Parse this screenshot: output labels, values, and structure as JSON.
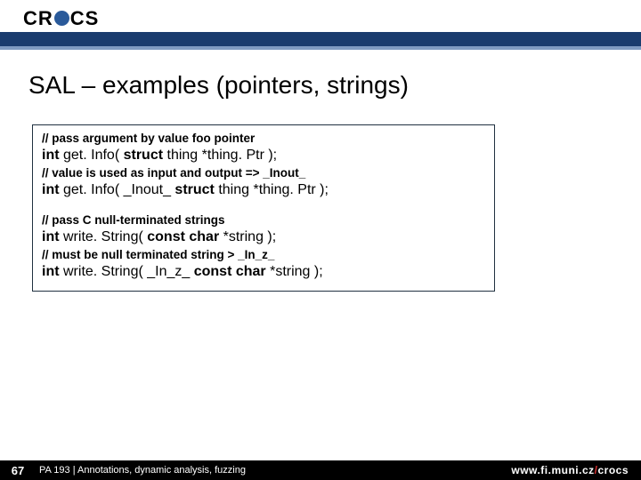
{
  "header": {
    "logo_left": "CR",
    "logo_right": "CS"
  },
  "title": "SAL – examples (pointers, strings)",
  "code": {
    "c1": "// pass argument by value foo pointer",
    "l1a": "int ",
    "l1b": "get. Info( ",
    "l1c": "struct ",
    "l1d": "thing *thing. Ptr );",
    "c2": "// value is used as input and output => _Inout_",
    "l2a": "int ",
    "l2b": "get. Info( _Inout_ ",
    "l2c": "struct ",
    "l2d": "thing *thing. Ptr );",
    "c3": "// pass C null-terminated strings",
    "l3a": "int ",
    "l3b": "write. String( ",
    "l3c": "const char ",
    "l3d": "*string );",
    "c4": "// must be null terminated string > _In_z_",
    "l4a": "int ",
    "l4b": "write. String( _In_z_ ",
    "l4c": "const char ",
    "l4d": "*string );"
  },
  "footer": {
    "page": "67",
    "text": "PA 193 | Annotations, dynamic analysis, fuzzing",
    "url_prefix": "www.fi.muni.cz",
    "url_slash": "/",
    "url_suffix": "crocs"
  }
}
